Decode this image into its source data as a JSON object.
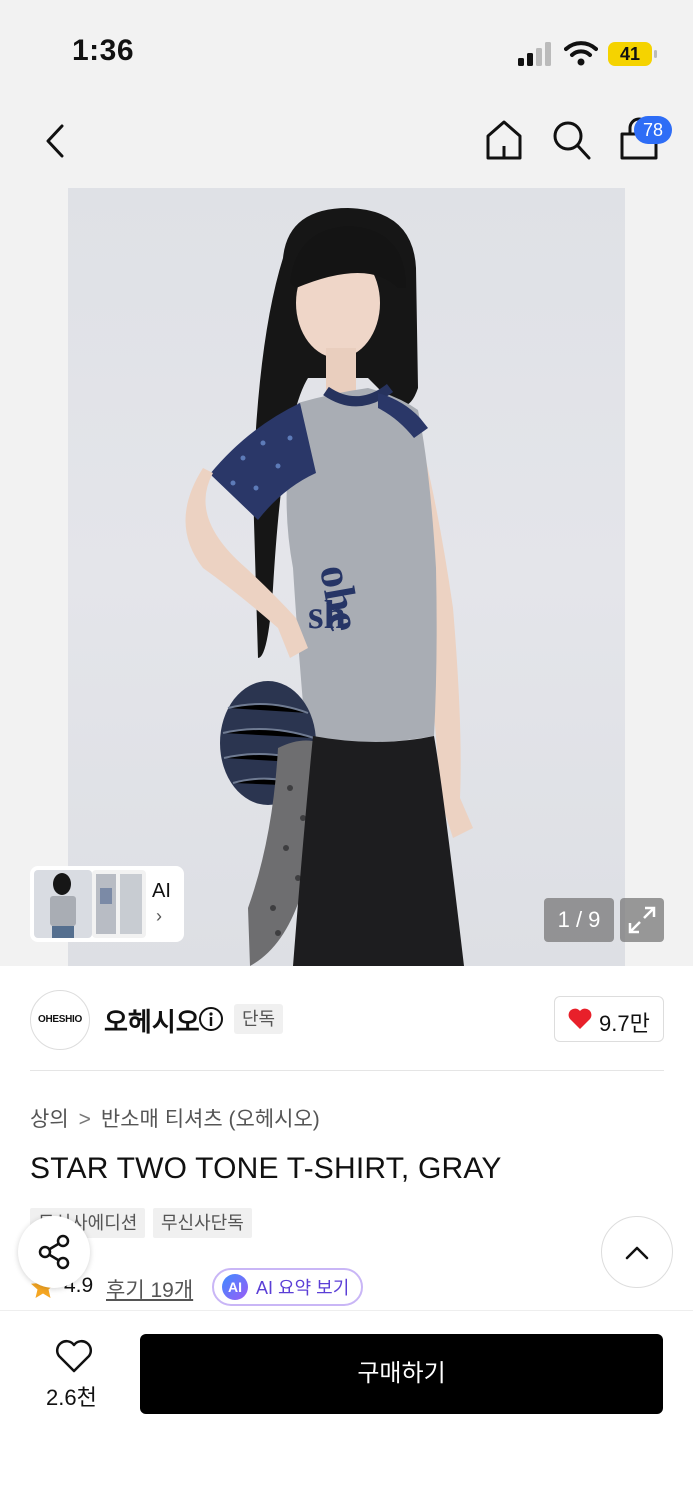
{
  "status_bar": {
    "time": "1:36",
    "battery": "41"
  },
  "nav": {
    "cart_count": "78"
  },
  "gallery": {
    "page_indicator": "1 / 9",
    "ai_label": "AI",
    "ai_chevron": "›"
  },
  "brand": {
    "logo_text": "OHESHIO",
    "name": "오헤시오",
    "exclusive_badge": "단독",
    "like_count": "9.7만"
  },
  "breadcrumb": {
    "items": [
      "상의",
      "반소매 티셔츠 (오헤시오)"
    ],
    "separator": ">"
  },
  "product": {
    "title": "STAR TWO TONE T-SHIRT, GRAY",
    "tags": [
      "무신사에디션",
      "무신사단독"
    ],
    "rating": "4.9",
    "review_link": "후기 19개",
    "ai_icon": "AI",
    "ai_summary": "AI 요약 보기"
  },
  "bottom_bar": {
    "wish_count": "2.6천",
    "buy_label": "구매하기"
  },
  "colors": {
    "accent_blue": "#2e6df6",
    "battery": "#f5d300",
    "heart": "#e8202a",
    "buy_button": "#000000"
  }
}
